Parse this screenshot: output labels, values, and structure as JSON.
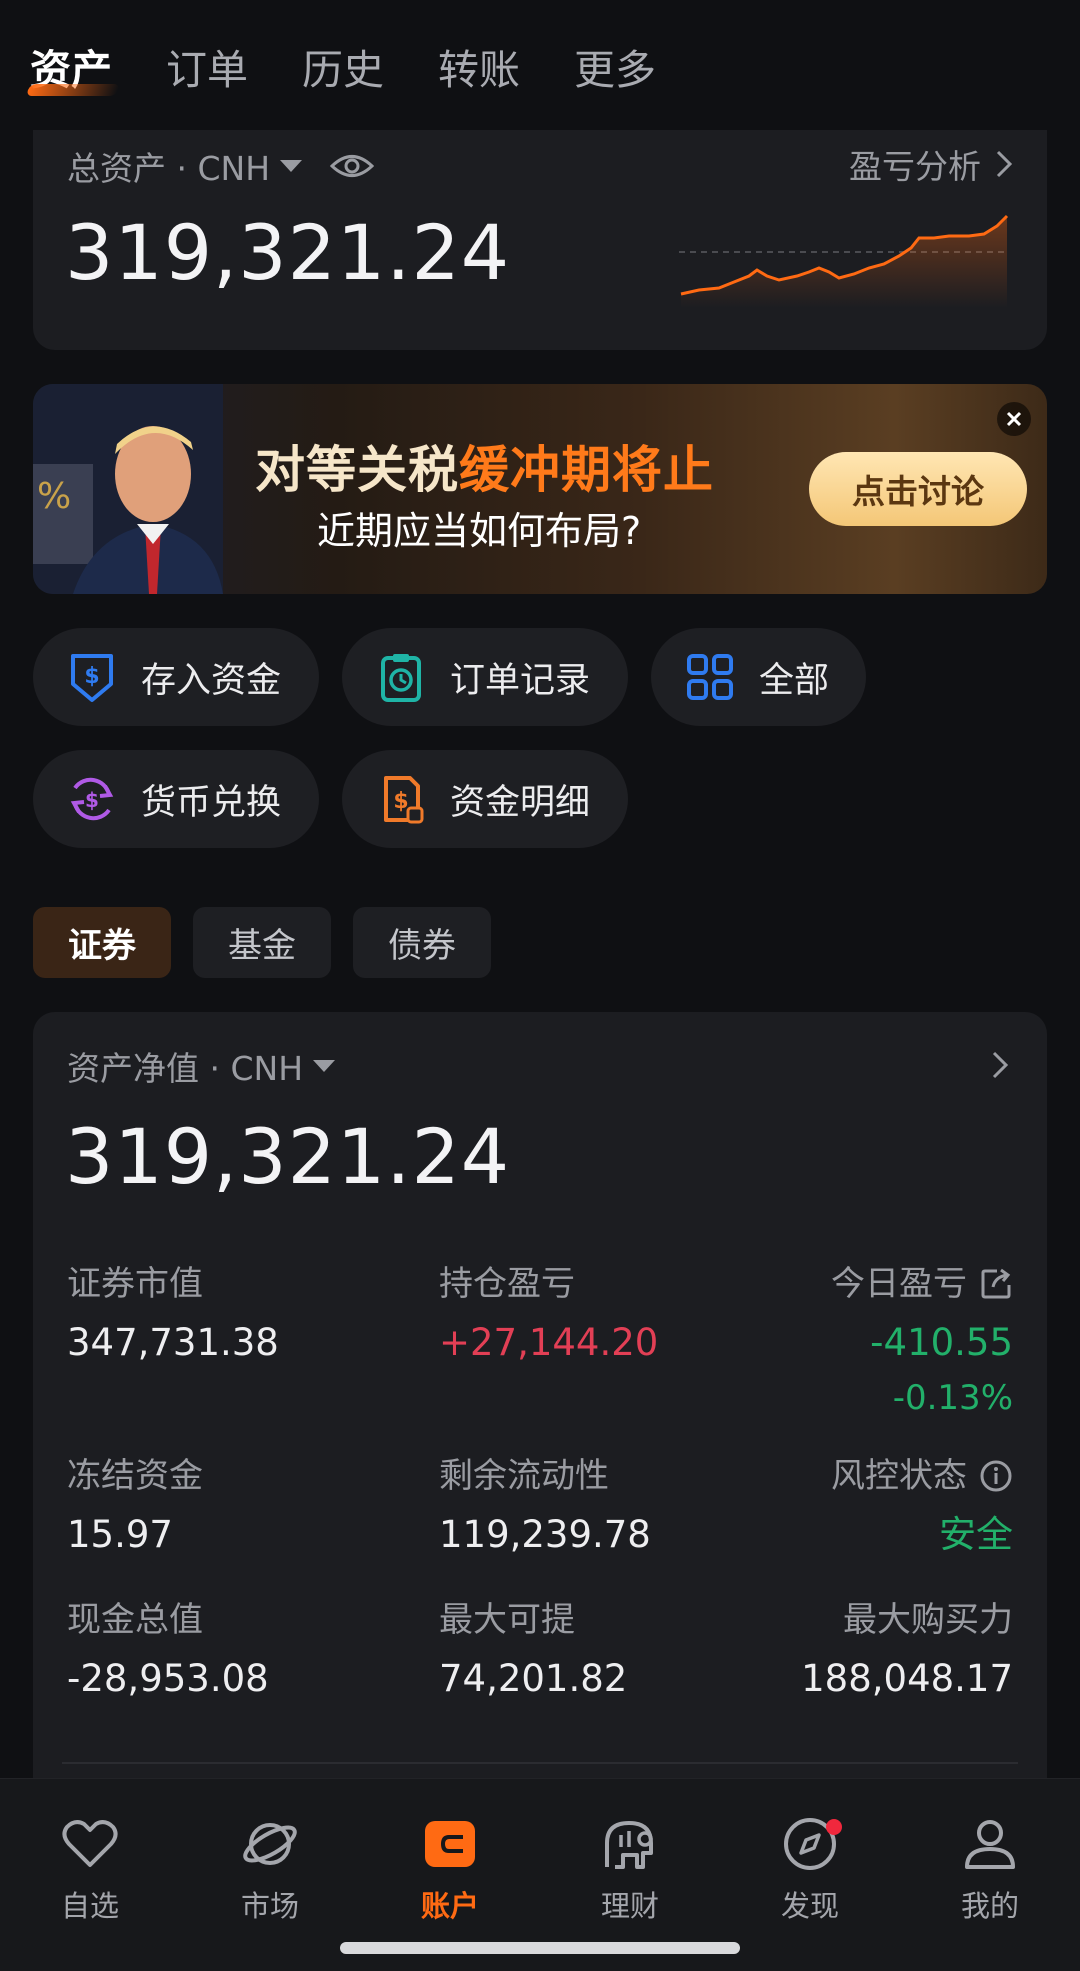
{
  "top_tabs": [
    "资产",
    "订单",
    "历史",
    "转账",
    "更多"
  ],
  "total_card": {
    "label": "总资产 · CNH",
    "pl_link": "盈亏分析",
    "value": "319,321.24"
  },
  "banner": {
    "title_plain": "对等关税",
    "title_highlight": "缓冲期将止",
    "subtitle": "近期应当如何布局?",
    "button": "点击讨论"
  },
  "quick_actions": [
    {
      "label": "存入资金",
      "icon": "deposit-icon",
      "color": "#2f7bf0"
    },
    {
      "label": "订单记录",
      "icon": "clipboard-clock-icon",
      "color": "#1fb4a6"
    },
    {
      "label": "全部",
      "icon": "grid-icon",
      "color": "#2f7bf0"
    },
    {
      "label": "货币兑换",
      "icon": "currency-exchange-icon",
      "color": "#b05ae6"
    },
    {
      "label": "资金明细",
      "icon": "fund-detail-icon",
      "color": "#f07a2a"
    }
  ],
  "segments": [
    "证券",
    "基金",
    "债券"
  ],
  "net_card": {
    "label": "资产净值 · CNH",
    "value": "319,321.24",
    "securities_mv": {
      "label": "证券市值",
      "value": "347,731.38"
    },
    "position_pl": {
      "label": "持仓盈亏",
      "value": "+27,144.20"
    },
    "today_pl": {
      "label": "今日盈亏",
      "value": "-410.55",
      "pct": "-0.13%"
    },
    "frozen": {
      "label": "冻结资金",
      "value": "15.97"
    },
    "liquidity": {
      "label": "剩余流动性",
      "value": "119,239.78"
    },
    "risk": {
      "label": "风控状态",
      "value": "安全"
    },
    "cash_total": {
      "label": "现金总值",
      "value": "-28,953.08"
    },
    "max_withdraw": {
      "label": "最大可提",
      "value": "74,201.82"
    },
    "max_buying_power": {
      "label": "最大购买力",
      "value": "188,048.17"
    }
  },
  "bottom_nav": [
    {
      "label": "自选",
      "icon": "heart-icon"
    },
    {
      "label": "市场",
      "icon": "planet-icon"
    },
    {
      "label": "账户",
      "icon": "wallet-icon"
    },
    {
      "label": "理财",
      "icon": "piggy-bank-icon"
    },
    {
      "label": "发现",
      "icon": "compass-icon"
    },
    {
      "label": "我的",
      "icon": "user-icon"
    }
  ],
  "colors": {
    "accent": "#ff6a13",
    "loss_red": "#e23f55",
    "gain_green": "#22b06a",
    "background": "#0f1013",
    "card": "#1c1d21"
  }
}
